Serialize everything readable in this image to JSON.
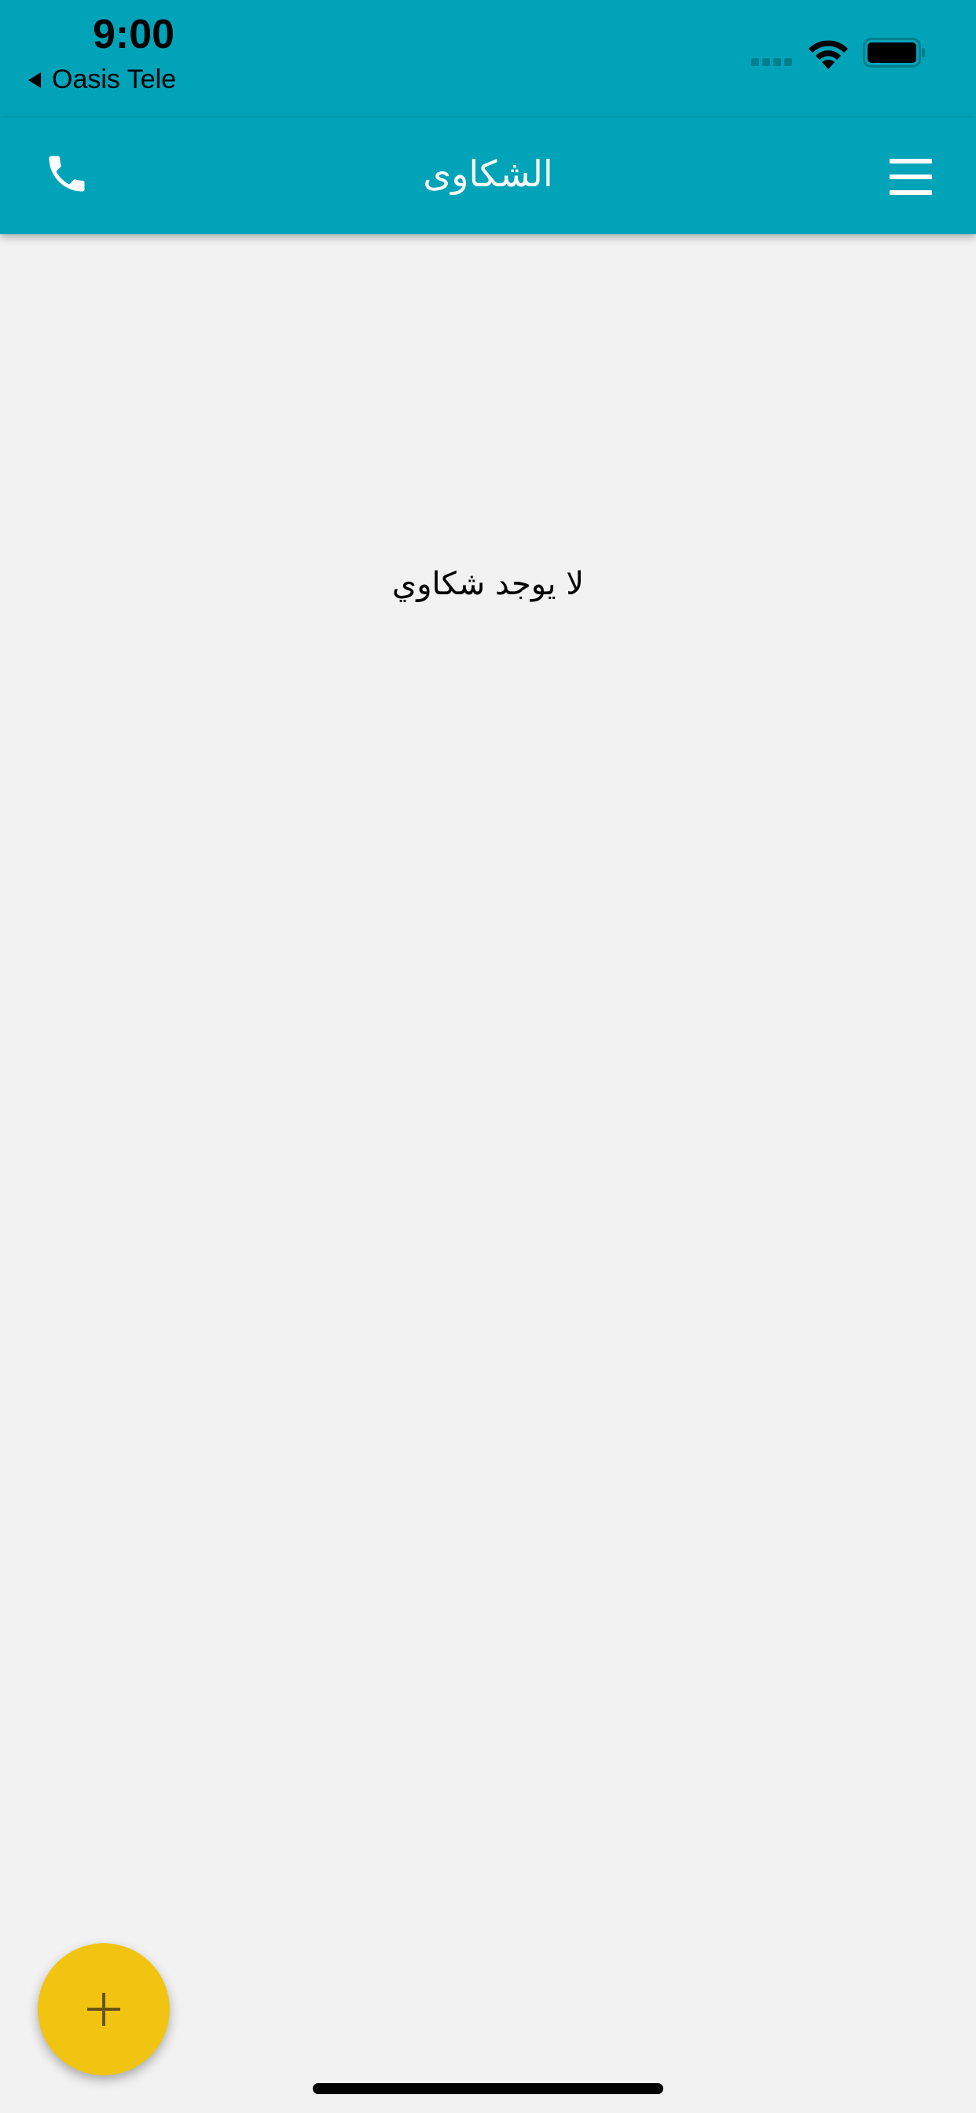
{
  "status_bar": {
    "time": "9:00",
    "back_app": "Oasis Tele",
    "icons": [
      "signal-icon",
      "wifi-icon",
      "battery-icon"
    ]
  },
  "app_bar": {
    "title": "الشكاوى",
    "left_icon": "phone-icon",
    "right_icon": "menu-icon"
  },
  "content": {
    "empty_message": "لا يوجد شكاوي"
  },
  "fab": {
    "icon": "plus-icon"
  },
  "colors": {
    "primary": "#00a3b8",
    "background": "#f2f2f2",
    "fab": "#f2c412"
  }
}
